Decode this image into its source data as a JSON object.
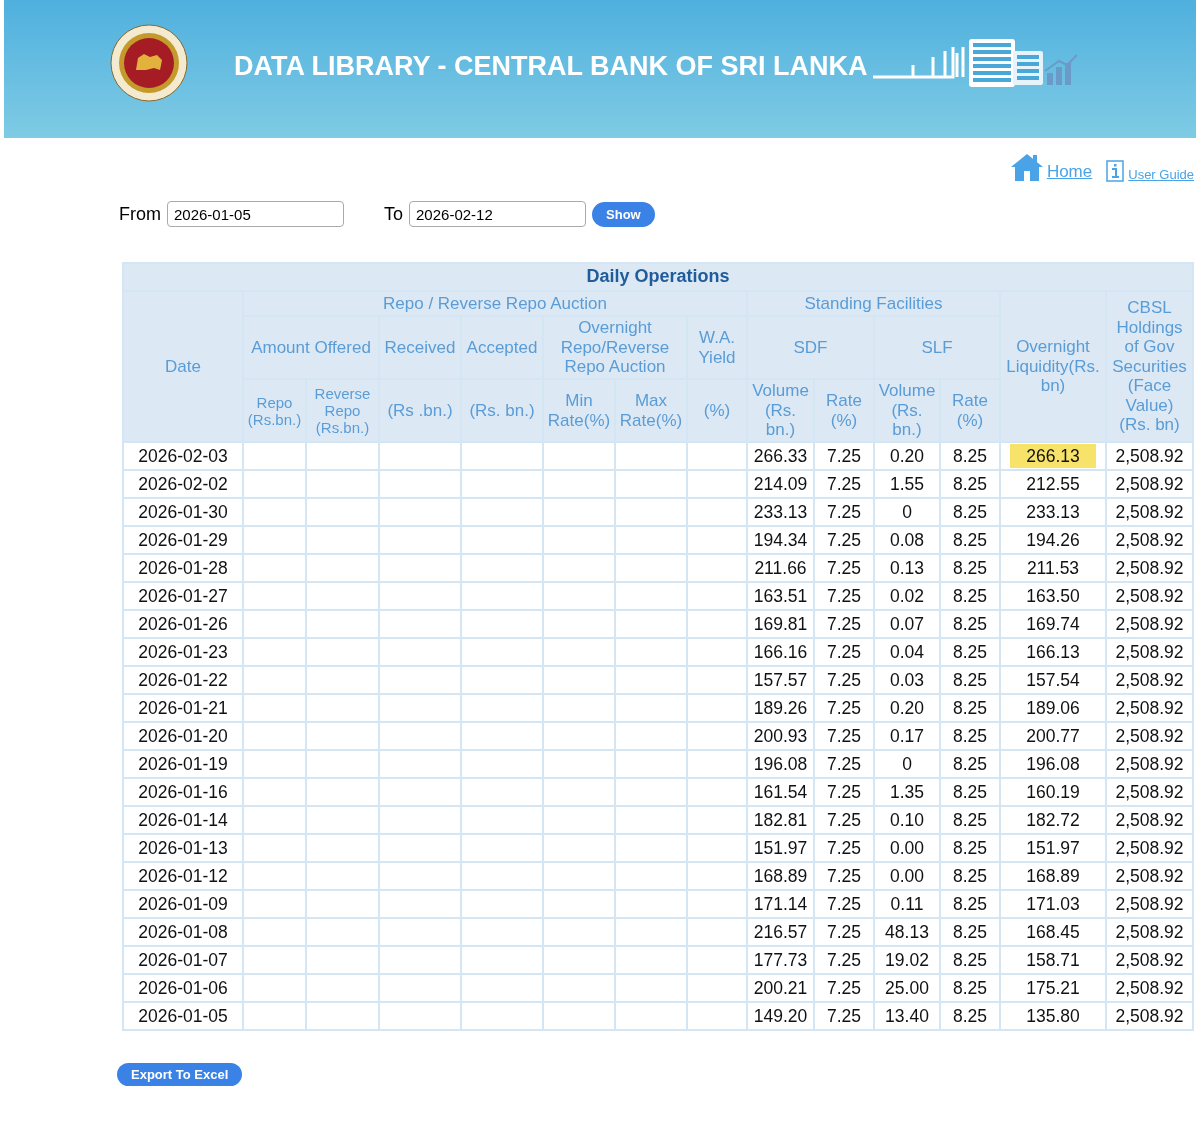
{
  "header": {
    "title": "DATA LIBRARY - CENTRAL BANK OF SRI LANKA"
  },
  "nav": [
    {
      "label": "Home",
      "kind": "home"
    },
    {
      "label": "User Guide",
      "kind": "guide"
    }
  ],
  "filter": {
    "from_label": "From",
    "from_value": "2026-01-05",
    "to_label": "To",
    "to_value": "2026-02-12",
    "button": "Show"
  },
  "table": {
    "title": "Daily Operations",
    "date_header": "Date",
    "groups": [
      "Repo / Reverse Repo Auction",
      "Standing Facilities"
    ],
    "overnight_header": "Overnight Liquidity(Rs. bn)",
    "cbsl_header": "CBSL Holdings of Gov Securities (Face Value) (Rs. bn)",
    "subheaders": [
      "Amount Offered",
      "Received",
      "Accepted",
      "Overnight Repo/Reverse Repo Auction",
      "W.A. Yield",
      "SDF",
      "SLF"
    ],
    "units": [
      "Repo (Rs.bn.)",
      "Reverse Repo (Rs.bn.)",
      "(Rs .bn.)",
      "(Rs. bn.)",
      "Min Rate(%)",
      "Max Rate(%)",
      "(%)",
      "Volume (Rs. bn.)",
      "Rate (%)",
      "Volume (Rs. bn.)",
      "Rate (%)"
    ],
    "rows": [
      {
        "date": "2026-02-03",
        "sdf_volume": "266.33",
        "sdf_rate": "7.25",
        "slf_volume": "0.20",
        "slf_rate": "8.25",
        "overnight_liquidity": "266.13",
        "cbsl_holdings": "2,508.92",
        "highlighted": true
      },
      {
        "date": "2026-02-02",
        "sdf_volume": "214.09",
        "sdf_rate": "7.25",
        "slf_volume": "1.55",
        "slf_rate": "8.25",
        "overnight_liquidity": "212.55",
        "cbsl_holdings": "2,508.92",
        "highlighted": false
      },
      {
        "date": "2026-01-30",
        "sdf_volume": "233.13",
        "sdf_rate": "7.25",
        "slf_volume": "0",
        "slf_rate": "8.25",
        "overnight_liquidity": "233.13",
        "cbsl_holdings": "2,508.92",
        "highlighted": false
      },
      {
        "date": "2026-01-29",
        "sdf_volume": "194.34",
        "sdf_rate": "7.25",
        "slf_volume": "0.08",
        "slf_rate": "8.25",
        "overnight_liquidity": "194.26",
        "cbsl_holdings": "2,508.92",
        "highlighted": false
      },
      {
        "date": "2026-01-28",
        "sdf_volume": "211.66",
        "sdf_rate": "7.25",
        "slf_volume": "0.13",
        "slf_rate": "8.25",
        "overnight_liquidity": "211.53",
        "cbsl_holdings": "2,508.92",
        "highlighted": false
      },
      {
        "date": "2026-01-27",
        "sdf_volume": "163.51",
        "sdf_rate": "7.25",
        "slf_volume": "0.02",
        "slf_rate": "8.25",
        "overnight_liquidity": "163.50",
        "cbsl_holdings": "2,508.92",
        "highlighted": false
      },
      {
        "date": "2026-01-26",
        "sdf_volume": "169.81",
        "sdf_rate": "7.25",
        "slf_volume": "0.07",
        "slf_rate": "8.25",
        "overnight_liquidity": "169.74",
        "cbsl_holdings": "2,508.92",
        "highlighted": false
      },
      {
        "date": "2026-01-23",
        "sdf_volume": "166.16",
        "sdf_rate": "7.25",
        "slf_volume": "0.04",
        "slf_rate": "8.25",
        "overnight_liquidity": "166.13",
        "cbsl_holdings": "2,508.92",
        "highlighted": false
      },
      {
        "date": "2026-01-22",
        "sdf_volume": "157.57",
        "sdf_rate": "7.25",
        "slf_volume": "0.03",
        "slf_rate": "8.25",
        "overnight_liquidity": "157.54",
        "cbsl_holdings": "2,508.92",
        "highlighted": false
      },
      {
        "date": "2026-01-21",
        "sdf_volume": "189.26",
        "sdf_rate": "7.25",
        "slf_volume": "0.20",
        "slf_rate": "8.25",
        "overnight_liquidity": "189.06",
        "cbsl_holdings": "2,508.92",
        "highlighted": false
      },
      {
        "date": "2026-01-20",
        "sdf_volume": "200.93",
        "sdf_rate": "7.25",
        "slf_volume": "0.17",
        "slf_rate": "8.25",
        "overnight_liquidity": "200.77",
        "cbsl_holdings": "2,508.92",
        "highlighted": false
      },
      {
        "date": "2026-01-19",
        "sdf_volume": "196.08",
        "sdf_rate": "7.25",
        "slf_volume": "0",
        "slf_rate": "8.25",
        "overnight_liquidity": "196.08",
        "cbsl_holdings": "2,508.92",
        "highlighted": false
      },
      {
        "date": "2026-01-16",
        "sdf_volume": "161.54",
        "sdf_rate": "7.25",
        "slf_volume": "1.35",
        "slf_rate": "8.25",
        "overnight_liquidity": "160.19",
        "cbsl_holdings": "2,508.92",
        "highlighted": false
      },
      {
        "date": "2026-01-14",
        "sdf_volume": "182.81",
        "sdf_rate": "7.25",
        "slf_volume": "0.10",
        "slf_rate": "8.25",
        "overnight_liquidity": "182.72",
        "cbsl_holdings": "2,508.92",
        "highlighted": false
      },
      {
        "date": "2026-01-13",
        "sdf_volume": "151.97",
        "sdf_rate": "7.25",
        "slf_volume": "0.00",
        "slf_rate": "8.25",
        "overnight_liquidity": "151.97",
        "cbsl_holdings": "2,508.92",
        "highlighted": false
      },
      {
        "date": "2026-01-12",
        "sdf_volume": "168.89",
        "sdf_rate": "7.25",
        "slf_volume": "0.00",
        "slf_rate": "8.25",
        "overnight_liquidity": "168.89",
        "cbsl_holdings": "2,508.92",
        "highlighted": false
      },
      {
        "date": "2026-01-09",
        "sdf_volume": "171.14",
        "sdf_rate": "7.25",
        "slf_volume": "0.11",
        "slf_rate": "8.25",
        "overnight_liquidity": "171.03",
        "cbsl_holdings": "2,508.92",
        "highlighted": false
      },
      {
        "date": "2026-01-08",
        "sdf_volume": "216.57",
        "sdf_rate": "7.25",
        "slf_volume": "48.13",
        "slf_rate": "8.25",
        "overnight_liquidity": "168.45",
        "cbsl_holdings": "2,508.92",
        "highlighted": false
      },
      {
        "date": "2026-01-07",
        "sdf_volume": "177.73",
        "sdf_rate": "7.25",
        "slf_volume": "19.02",
        "slf_rate": "8.25",
        "overnight_liquidity": "158.71",
        "cbsl_holdings": "2,508.92",
        "highlighted": false
      },
      {
        "date": "2026-01-06",
        "sdf_volume": "200.21",
        "sdf_rate": "7.25",
        "slf_volume": "25.00",
        "slf_rate": "8.25",
        "overnight_liquidity": "175.21",
        "cbsl_holdings": "2,508.92",
        "highlighted": false
      },
      {
        "date": "2026-01-05",
        "sdf_volume": "149.20",
        "sdf_rate": "7.25",
        "slf_volume": "13.40",
        "slf_rate": "8.25",
        "overnight_liquidity": "135.80",
        "cbsl_holdings": "2,508.92",
        "highlighted": false
      }
    ]
  },
  "export_button": "Export To Excel"
}
